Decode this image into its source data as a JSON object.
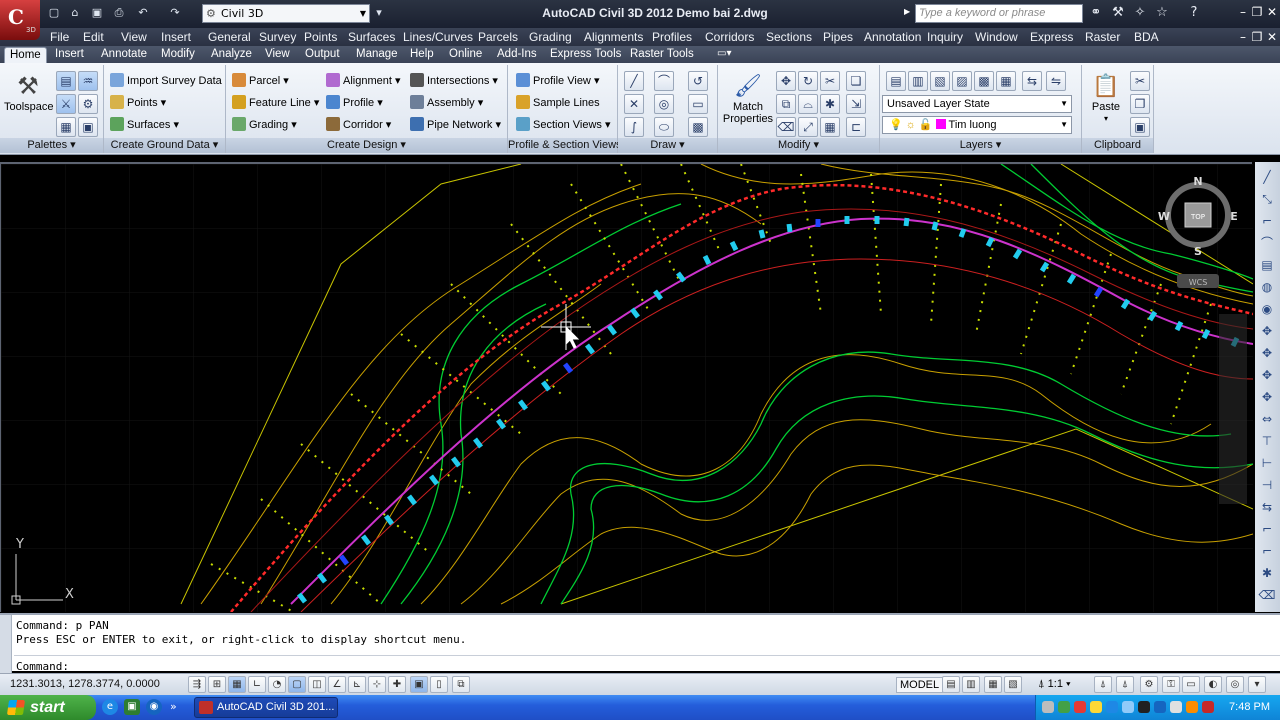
{
  "titlebar": {
    "workspace": "Civil 3D",
    "title": "AutoCAD Civil 3D 2012    Demo bai 2.dwg",
    "search_placeholder": "Type a keyword or phrase",
    "app_letter": "C",
    "app_sub": "3D"
  },
  "menubar": [
    "File",
    "Edit",
    "View",
    "Insert",
    "General",
    "Survey",
    "Points",
    "Surfaces",
    "Lines/Curves",
    "Parcels",
    "Grading",
    "Alignments",
    "Profiles",
    "Corridors",
    "Sections",
    "Pipes",
    "Annotation",
    "Inquiry",
    "Window",
    "Express",
    "Raster",
    "BDA"
  ],
  "tabs": [
    "Home",
    "Insert",
    "Annotate",
    "Modify",
    "Analyze",
    "View",
    "Output",
    "Manage",
    "Help",
    "Online",
    "Add-Ins",
    "Express Tools",
    "Raster Tools"
  ],
  "ribbon": {
    "palettes": {
      "title": "Palettes",
      "toolspace": "Toolspace"
    },
    "ground": {
      "title": "Create Ground Data",
      "import": "Import Survey Data",
      "points": "Points",
      "surfaces": "Surfaces"
    },
    "design": {
      "title": "Create Design",
      "parcel": "Parcel",
      "feature_line": "Feature Line",
      "grading": "Grading",
      "alignment": "Alignment",
      "profile": "Profile",
      "corridor": "Corridor",
      "intersections": "Intersections",
      "assembly": "Assembly",
      "pipe_network": "Pipe Network"
    },
    "profile_section": {
      "title": "Profile & Section Views",
      "profile_view": "Profile View",
      "sample_lines": "Sample Lines",
      "section_views": "Section Views"
    },
    "draw": {
      "title": "Draw"
    },
    "modify": {
      "title": "Modify",
      "match_properties": "Match Properties"
    },
    "layers": {
      "title": "Layers",
      "layer_state": "Unsaved Layer State",
      "current_layer": "Tim luong"
    },
    "clipboard": {
      "title": "Clipboard",
      "paste": "Paste"
    }
  },
  "viewcube": {
    "north": "N",
    "south": "S",
    "east": "E",
    "west": "W",
    "face": "TOP",
    "wcs": "WCS"
  },
  "ucs": {
    "x": "X",
    "y": "Y"
  },
  "command": {
    "line1": "Command: p PAN",
    "line2": "Press ESC or ENTER to exit, or right-click to display shortcut menu.",
    "prompt": "Command:"
  },
  "status": {
    "coords": "1231.3013, 1278.3774, 0.0000",
    "model": "MODEL",
    "scale": "1:1"
  },
  "taskbar": {
    "start": "start",
    "app": "AutoCAD Civil 3D 201...",
    "clock": "7:48 PM"
  },
  "colors": {
    "alignment": "#cc33cc",
    "stations": "#22ccee",
    "offset_left": "#ff2a2a",
    "contour_green": "#00cc33",
    "contour_gold": "#c8a000"
  }
}
